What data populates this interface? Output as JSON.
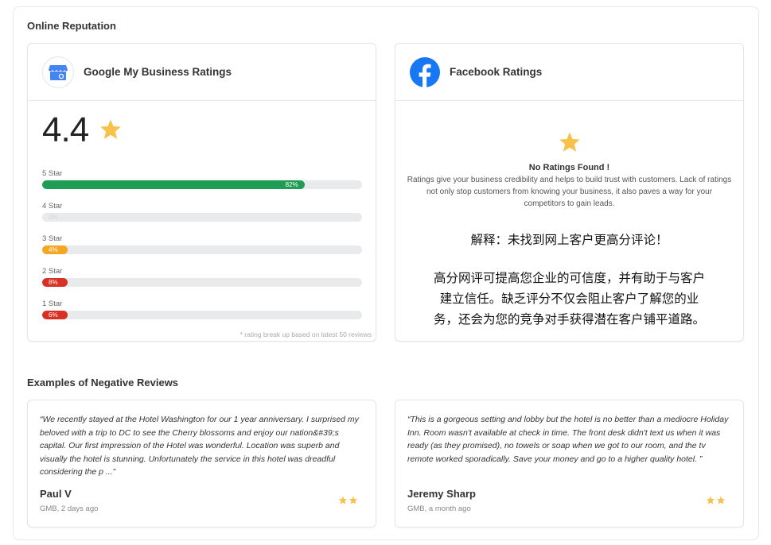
{
  "section_reputation": "Online Reputation",
  "gmb": {
    "title": "Google My Business Ratings",
    "average": "4.4",
    "rows": [
      {
        "label": "5 Star",
        "percent": 82,
        "pct_text": "82%",
        "color": "#1f9d55"
      },
      {
        "label": "4 Star",
        "percent": 0,
        "pct_text": "0%",
        "color": "#1f9d55"
      },
      {
        "label": "3 Star",
        "percent": 4,
        "pct_text": "4%",
        "color": "#f5a623"
      },
      {
        "label": "2 Star",
        "percent": 8,
        "pct_text": "8%",
        "color": "#d93025"
      },
      {
        "label": "1 Star",
        "percent": 6,
        "pct_text": "6%",
        "color": "#d93025"
      }
    ],
    "note": "* rating break up based on latest 50 reviews"
  },
  "facebook": {
    "title": "Facebook Ratings",
    "empty_title": "No Ratings Found !",
    "empty_desc": "Ratings give your business credibility and helps to build trust with customers. Lack of ratings not only stop customers from knowing your business, it also paves a way for your competitors to gain leads.",
    "cn_line1": "解释：未找到网上客户更高分评论！",
    "cn_line2": "高分网评可提高您企业的可信度，并有助于与客户",
    "cn_line3": "建立信任。缺乏评分不仅会阻止客户了解您的业",
    "cn_line4": "务，还会为您的竞争对手获得潜在客户铺平道路。"
  },
  "section_negative": "Examples of Negative Reviews",
  "reviews": [
    {
      "text": "“We recently stayed at the Hotel Washington for our 1 year anniversary. I surprised my beloved with a trip to DC to see the Cherry blossoms and enjoy our nation&#39;s capital. Our first impression of the Hotel was wonderful. Location was superb and visually the hotel is stunning. Unfortunately the service in this hotel was dreadful considering the p ...”",
      "author": "Paul V",
      "meta": "GMB, 2 days ago",
      "stars": 2
    },
    {
      "text": "“This is a gorgeous setting and lobby but the hotel is no better than a mediocre Holiday Inn. Room wasn't available at check in time. The front desk didn't text us when it was ready (as they promised), no towels or soap when we got to our room, and the tv remote worked sporadically. Save your money and go to a higher quality hotel. ”",
      "author": "Jeremy Sharp",
      "meta": "GMB, a month ago",
      "stars": 2
    }
  ],
  "colors": {
    "star": "#f7c14a",
    "facebook_blue": "#1877f2"
  }
}
